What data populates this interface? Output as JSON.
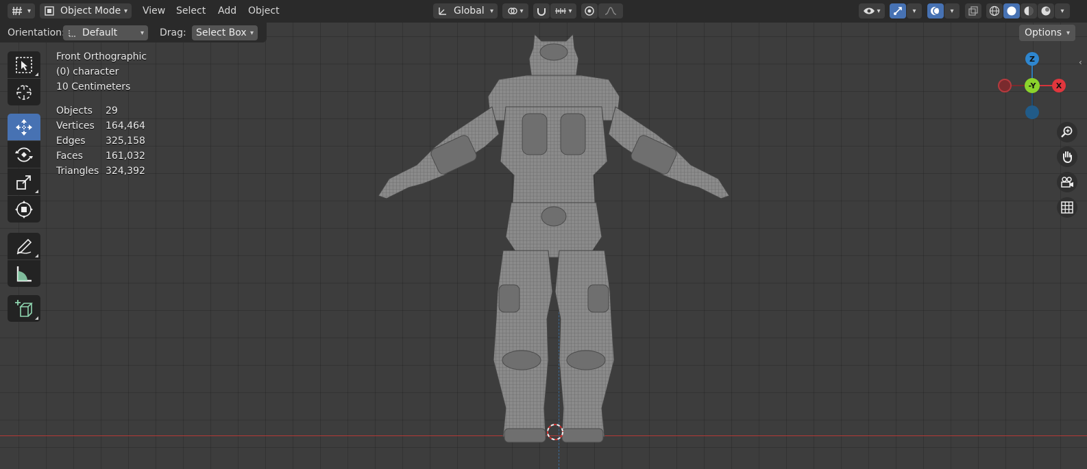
{
  "header": {
    "editor_type_icon": "editor-type-icon",
    "mode": "Object Mode",
    "menu": [
      "View",
      "Select",
      "Add",
      "Object"
    ],
    "orientation": "Global",
    "colors": {
      "header_bg": "#2a2a2a",
      "accent": "#4772b3",
      "viewport_bg": "#3d3d3d"
    }
  },
  "tool_settings": {
    "orientation_label": "Orientation:",
    "orientation_value": "Default",
    "drag_label": "Drag:",
    "drag_value": "Select Box",
    "options_label": "Options"
  },
  "overlay": {
    "view_name": "Front Orthographic",
    "collection": "(0) character",
    "scale": "10 Centimeters"
  },
  "stats": [
    {
      "label": "Objects",
      "value": "29"
    },
    {
      "label": "Vertices",
      "value": "164,464"
    },
    {
      "label": "Edges",
      "value": "325,158"
    },
    {
      "label": "Faces",
      "value": "161,032"
    },
    {
      "label": "Triangles",
      "value": "324,392"
    }
  ],
  "toolbar": [
    {
      "name": "select-box-tool",
      "icon": "select-box-icon",
      "active": false
    },
    {
      "name": "cursor-tool",
      "icon": "cursor-icon",
      "active": false
    },
    {
      "name": "move-tool",
      "icon": "move-icon",
      "active": true
    },
    {
      "name": "rotate-tool",
      "icon": "rotate-icon",
      "active": false
    },
    {
      "name": "scale-tool",
      "icon": "scale-icon",
      "active": false
    },
    {
      "name": "transform-tool",
      "icon": "transform-icon",
      "active": false
    },
    {
      "name": "annotate-tool",
      "icon": "annotate-icon",
      "active": false
    },
    {
      "name": "measure-tool",
      "icon": "measure-icon",
      "active": false
    },
    {
      "name": "add-cube-tool",
      "icon": "add-cube-icon",
      "active": false
    }
  ],
  "gizmo": {
    "z": "Z",
    "y": "-Y",
    "x": "X"
  },
  "nav_buttons": [
    "zoom-icon",
    "pan-hand-icon",
    "camera-icon",
    "grid-ortho-icon"
  ]
}
